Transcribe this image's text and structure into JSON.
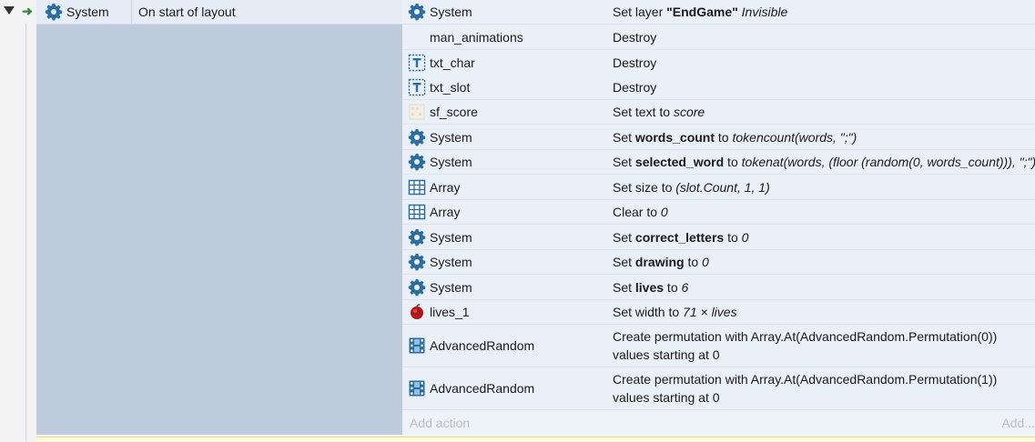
{
  "event": {
    "condition_object": "System",
    "condition_text": "On start of layout",
    "trigger_glyph": "➜"
  },
  "actions": [
    {
      "object": "System",
      "icon": "gear-icon",
      "parts": [
        "Set layer ",
        "\"EndGame\"",
        " ",
        "Invisible"
      ]
    },
    {
      "object": "man_animations",
      "icon": "",
      "text": "Destroy"
    },
    {
      "object": "txt_char",
      "icon": "text-object-icon",
      "text": "Destroy"
    },
    {
      "object": "txt_slot",
      "icon": "text-object-icon",
      "text": "Destroy"
    },
    {
      "object": "sf_score",
      "icon": "spritefont-icon",
      "parts": [
        "Set text to ",
        "score"
      ]
    },
    {
      "object": "System",
      "icon": "gear-icon",
      "parts": [
        "Set ",
        "words_count",
        " to ",
        "tokencount(words, \";\")"
      ]
    },
    {
      "object": "System",
      "icon": "gear-icon",
      "parts": [
        "Set ",
        "selected_word",
        " to ",
        "tokenat(words, (floor (random(0, words_count))), \";\")"
      ]
    },
    {
      "object": "Array",
      "icon": "array-grid-icon",
      "parts": [
        "Set size to ",
        "(slot.Count, 1, 1)"
      ]
    },
    {
      "object": "Array",
      "icon": "array-grid-icon",
      "parts": [
        "Clear to ",
        "0"
      ]
    },
    {
      "object": "System",
      "icon": "gear-icon",
      "parts": [
        "Set ",
        "correct_letters",
        " to ",
        "0"
      ]
    },
    {
      "object": "System",
      "icon": "gear-icon",
      "parts": [
        "Set ",
        "drawing",
        " to ",
        "0"
      ]
    },
    {
      "object": "System",
      "icon": "gear-icon",
      "parts": [
        "Set ",
        "lives",
        " to ",
        "6"
      ]
    },
    {
      "object": "lives_1",
      "icon": "sprite-apple-icon",
      "parts": [
        "Set width to ",
        "71 × lives"
      ]
    },
    {
      "object": "AdvancedRandom",
      "icon": "film-strip-icon",
      "text": "Create permutation with Array.At(AdvancedRandom.Permutation(0)) values starting at 0"
    },
    {
      "object": "AdvancedRandom",
      "icon": "film-strip-icon",
      "text": "Create permutation with Array.At(AdvancedRandom.Permutation(1)) values starting at 0"
    }
  ],
  "footer": {
    "add_action": "Add action",
    "add_more": "Add..."
  },
  "colors": {
    "event_block": "#bdcbdc",
    "action_row": "#eaf0f8",
    "gear": "#2a6d9e",
    "trigger_arrow": "#2e8b3a"
  }
}
